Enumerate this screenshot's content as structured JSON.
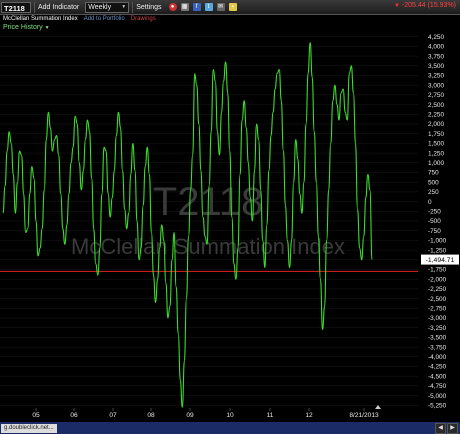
{
  "toolbar": {
    "symbol": "T2118",
    "add_indicator": "Add Indicator",
    "period_value": "Weekly",
    "settings": "Settings",
    "change": "-205.44 (15.93%)"
  },
  "subheader": {
    "title": "McClellan Summation Index",
    "add_to_portfolio": "Add to Portfolio",
    "drawings": "Drawings"
  },
  "price_history_label": "Price History",
  "status": {
    "text": "g.doubleclick.net..."
  },
  "colors": {
    "line": "#3cdc2a",
    "ref_line": "#c81e1e",
    "last_badge_bg": "#ffffff",
    "grid": "#1a1a1a"
  },
  "chart_data": {
    "type": "line",
    "watermark_symbol": "T2118",
    "watermark_name": "McClellan Summation Index",
    "x_tick_labels": [
      "05",
      "06",
      "07",
      "08",
      "09",
      "10",
      "11",
      "12",
      "8/21/2013"
    ],
    "y_ticks": [
      4250,
      4000,
      3750,
      3500,
      3250,
      3000,
      2750,
      2500,
      2250,
      2000,
      1750,
      1500,
      1250,
      1000,
      750,
      500,
      250,
      0,
      -250,
      -500,
      -750,
      -1000,
      -1250,
      -1500,
      -1750,
      -2000,
      -2250,
      -2500,
      -2750,
      -3000,
      -3250,
      -3500,
      -3750,
      -4000,
      -4250,
      -4500,
      -4750,
      -5000,
      -5250
    ],
    "ylim": [
      -5320,
      4370
    ],
    "reference_line": -1800,
    "last_value_label": "-1,494.71",
    "last_value": -1495,
    "series": [
      {
        "values": [
          -300,
          400,
          1300,
          1800,
          1500,
          700,
          -300,
          500,
          1300,
          1200,
          200,
          -800,
          -700,
          200,
          900,
          600,
          -500,
          -1400,
          -1200,
          -700,
          300,
          1600,
          2300,
          1900,
          1300,
          1600,
          1700,
          1200,
          200,
          -700,
          -1100,
          -600,
          200,
          1000,
          1400,
          2200,
          2000,
          1000,
          300,
          800,
          1600,
          2100,
          1800,
          600,
          -700,
          -1600,
          -1900,
          -1200,
          200,
          1400,
          1300,
          200,
          -400,
          100,
          800,
          1700,
          2300,
          1900,
          800,
          -200,
          -700,
          -300,
          700,
          1500,
          800,
          -500,
          -1500,
          -1200,
          -100,
          900,
          1400,
          700,
          -800,
          -1900,
          -2600,
          -2000,
          -1200,
          -600,
          -1000,
          -2100,
          -3000,
          -2700,
          -1500,
          -800,
          -2200,
          -3400,
          -4600,
          -5300,
          -4100,
          -2500,
          -900,
          300,
          1200,
          3300,
          3000,
          2000,
          800,
          -400,
          -900,
          -1100,
          400,
          1800,
          3400,
          3100,
          1800,
          1200,
          2300,
          3100,
          3600,
          2800,
          1300,
          -400,
          -1600,
          -2000,
          -1200,
          700,
          2100,
          2600,
          1900,
          1000,
          100,
          -500,
          800,
          2000,
          1600,
          300,
          -1000,
          -1700,
          -600,
          800,
          1700,
          2300,
          2900,
          3300,
          3400,
          2600,
          1300,
          -100,
          -1000,
          -1700,
          -1000,
          500,
          1600,
          1100,
          200,
          -300,
          500,
          2000,
          3300,
          4100,
          3200,
          1800,
          500,
          -900,
          -2000,
          -3300,
          -2700,
          -1000,
          300,
          1500,
          2600,
          3000,
          2500,
          2100,
          2800,
          2900,
          2300,
          2100,
          3300,
          3500,
          2800,
          1500,
          -200,
          -1200,
          -1500,
          -900,
          100,
          700,
          300,
          -1500
        ]
      }
    ]
  }
}
